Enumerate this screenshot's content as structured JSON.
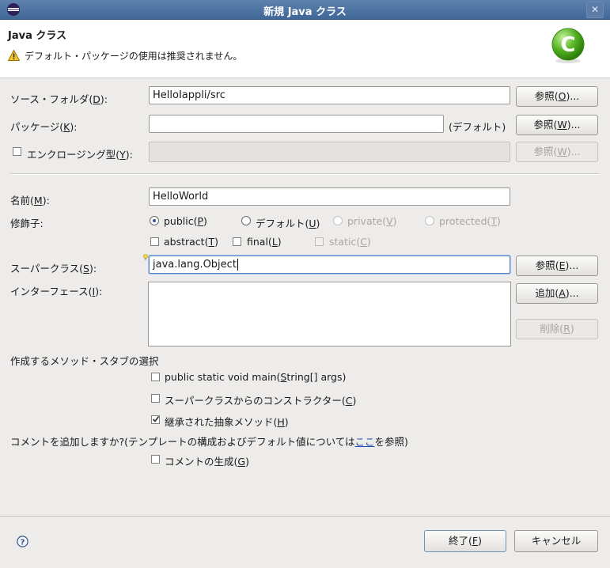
{
  "window": {
    "title": "新規 Java クラス"
  },
  "header": {
    "title": "Java クラス",
    "message": "デフォルト・パッケージの使用は推奨されません。"
  },
  "source_folder": {
    "label_pre": "ソース・フォルダ(",
    "mnemonic": "D",
    "label_post": "):",
    "value": "HelloIappli/src",
    "browse": {
      "pre": "参照(",
      "m": "O",
      "post": ")..."
    }
  },
  "package": {
    "label_pre": "パッケージ(",
    "mnemonic": "K",
    "label_post": "):",
    "value": "",
    "default_hint": "(デフォルト)",
    "browse": {
      "pre": "参照(",
      "m": "W",
      "post": ")..."
    }
  },
  "enclosing": {
    "label_pre": "エンクロージング型(",
    "mnemonic": "Y",
    "label_post": "):",
    "checked": false,
    "browse": {
      "pre": "参照(",
      "m": "W",
      "post": ")..."
    }
  },
  "name": {
    "label_pre": "名前(",
    "mnemonic": "M",
    "label_post": "):",
    "value": "HelloWorld"
  },
  "modifiers": {
    "label": "修飾子:",
    "access": [
      {
        "pre": "public(",
        "m": "P",
        "post": ")",
        "selected": true,
        "enabled": true
      },
      {
        "pre": "デフォルト(",
        "m": "U",
        "post": ")",
        "selected": false,
        "enabled": true
      },
      {
        "pre": "private(",
        "m": "V",
        "post": ")",
        "selected": false,
        "enabled": false
      },
      {
        "pre": "protected(",
        "m": "T",
        "post": ")",
        "selected": false,
        "enabled": false
      }
    ],
    "flags": [
      {
        "pre": "abstract(",
        "m": "T",
        "post": ")",
        "checked": false,
        "enabled": true
      },
      {
        "pre": "final(",
        "m": "L",
        "post": ")",
        "checked": false,
        "enabled": true
      },
      {
        "pre": "static(",
        "m": "C",
        "post": ")",
        "checked": false,
        "enabled": false
      }
    ]
  },
  "superclass": {
    "label_pre": "スーパークラス(",
    "mnemonic": "S",
    "label_post": "):",
    "value": "java.lang.Object",
    "browse": {
      "pre": "参照(",
      "m": "E",
      "post": ")..."
    }
  },
  "interfaces": {
    "label_pre": "インターフェース(",
    "mnemonic": "I",
    "label_post": "):",
    "add": {
      "pre": "追加(",
      "m": "A",
      "post": ")..."
    },
    "remove": {
      "pre": "削除(",
      "m": "R",
      "post": ")"
    }
  },
  "stubs": {
    "label": "作成するメソッド・スタブの選択",
    "items": [
      {
        "pre": "public static void main(",
        "m": "S",
        "post": "tring[] args)",
        "checked": false
      },
      {
        "pre": "スーパークラスからのコンストラクター(",
        "m": "C",
        "post": ")",
        "checked": false
      },
      {
        "pre": "継承された抽象メソッド(",
        "m": "H",
        "post": ")",
        "checked": true
      }
    ]
  },
  "comments": {
    "question_pre": "コメントを追加しますか?(テンプレートの構成およびデフォルト値については",
    "link": "ここ",
    "question_post": "を参照)",
    "generate": {
      "pre": "コメントの生成(",
      "m": "G",
      "post": ")",
      "checked": false
    }
  },
  "footer": {
    "help_icon": "help-icon",
    "finish": {
      "pre": "終了(",
      "m": "F",
      "post": ")"
    },
    "cancel": "キャンセル"
  }
}
